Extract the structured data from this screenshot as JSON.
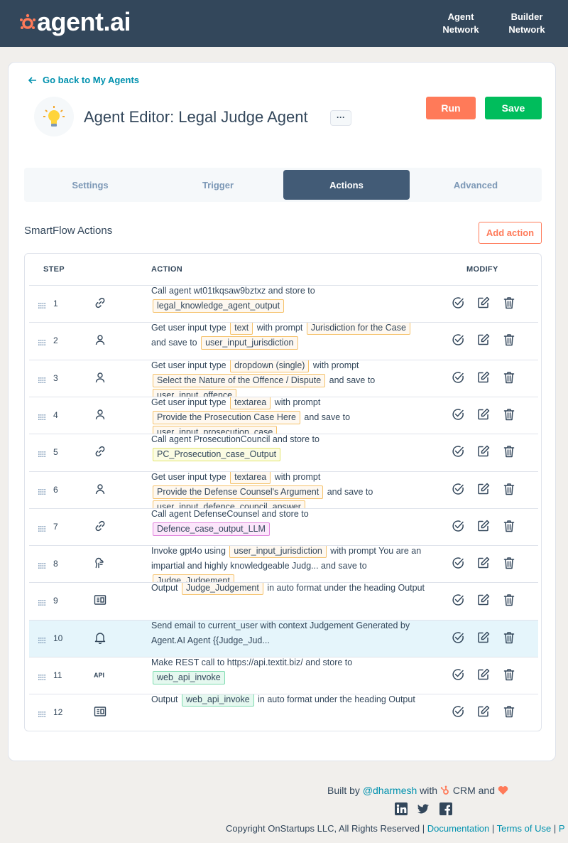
{
  "header": {
    "logo_text": "agent.ai",
    "nav": [
      {
        "line1": "Agent",
        "line2": "Network"
      },
      {
        "line1": "Builder",
        "line2": "Network"
      }
    ]
  },
  "editor": {
    "back_label": "Go back to My Agents",
    "title": "Agent Editor: Legal Judge Agent",
    "more_label": "···",
    "run_label": "Run",
    "save_label": "Save",
    "tabs": [
      "Settings",
      "Trigger",
      "Actions",
      "Advanced"
    ],
    "active_tab": "Actions",
    "section_title": "SmartFlow Actions",
    "add_action_label": "Add action"
  },
  "table": {
    "headers": {
      "step": "STEP",
      "action": "ACTION",
      "modify": "MODIFY"
    },
    "rows": [
      {
        "step": "1",
        "icon": "link-icon",
        "parts": [
          [
            "t",
            "Call agent wt01tkqsaw9bztxz and store to "
          ],
          [
            "tag",
            "legal_knowledge_agent_output"
          ]
        ]
      },
      {
        "step": "2",
        "icon": "user-icon",
        "parts": [
          [
            "t",
            "Get user input type "
          ],
          [
            "tag",
            "text"
          ],
          [
            "t",
            " with prompt "
          ],
          [
            "tag",
            "Jurisdiction for the Case"
          ],
          [
            "t",
            " and save to "
          ],
          [
            "tag",
            "user_input_jurisdiction"
          ]
        ]
      },
      {
        "step": "3",
        "icon": "user-icon",
        "parts": [
          [
            "t",
            "Get user input type "
          ],
          [
            "tag",
            "dropdown (single)"
          ],
          [
            "t",
            " with prompt "
          ],
          [
            "tag",
            "Select the Nature of the Offence / Dispute"
          ],
          [
            "t",
            " and save to "
          ],
          [
            "tag",
            "user_input_offence"
          ]
        ]
      },
      {
        "step": "4",
        "icon": "user-icon",
        "parts": [
          [
            "t",
            "Get user input type "
          ],
          [
            "tag",
            "textarea"
          ],
          [
            "t",
            " with prompt "
          ],
          [
            "tag",
            "Provide the Prosecution Case Here"
          ],
          [
            "t",
            " and save to "
          ],
          [
            "tag",
            "user_input_prosecution_case"
          ]
        ]
      },
      {
        "step": "5",
        "icon": "link-icon",
        "parts": [
          [
            "t",
            "Call agent ProsecutionCouncil and store to "
          ],
          [
            "tag-yellow",
            "PC_Prosecution_case_Output"
          ]
        ]
      },
      {
        "step": "6",
        "icon": "user-icon",
        "parts": [
          [
            "t",
            "Get user input type "
          ],
          [
            "tag",
            "textarea"
          ],
          [
            "t",
            " with prompt "
          ],
          [
            "tag",
            "Provide the Defense Counsel's Argument"
          ],
          [
            "t",
            " and save to "
          ],
          [
            "tag",
            "user_input_defence_council_answer"
          ]
        ]
      },
      {
        "step": "7",
        "icon": "link-icon",
        "parts": [
          [
            "t",
            "Call agent DefenseCounsel and store to "
          ],
          [
            "tag-pink",
            "Defence_case_output_LLM"
          ]
        ]
      },
      {
        "step": "8",
        "icon": "brain-icon",
        "parts": [
          [
            "t",
            "Invoke gpt4o using "
          ],
          [
            "tag",
            "user_input_jurisdiction"
          ],
          [
            "t",
            " with prompt You are an impartial and highly knowledgeable Judg... and save to "
          ],
          [
            "tag",
            "Judge_Judgement"
          ]
        ]
      },
      {
        "step": "9",
        "icon": "output-icon",
        "parts": [
          [
            "t",
            "Output "
          ],
          [
            "tag",
            "Judge_Judgement"
          ],
          [
            "t",
            " in auto format under the heading Output"
          ]
        ]
      },
      {
        "step": "10",
        "icon": "bell-icon",
        "parts": [
          [
            "t",
            "Send email to current_user with context Judgement Generated by Agent.AI Agent {{Judge_Jud..."
          ]
        ]
      },
      {
        "step": "11",
        "icon": "api-icon",
        "parts": [
          [
            "t",
            "Make REST call to https://api.textit.biz/ and store to "
          ],
          [
            "tag-green",
            "web_api_invoke"
          ]
        ]
      },
      {
        "step": "12",
        "icon": "output-icon",
        "parts": [
          [
            "t",
            "Output "
          ],
          [
            "tag-green",
            "web_api_invoke"
          ],
          [
            "t",
            " in auto format under the heading Output"
          ]
        ]
      }
    ]
  },
  "footer": {
    "built_by": "Built by",
    "handle": "@dharmesh",
    "with": "with",
    "crm": "CRM and",
    "copyright": "Copyright OnStartups LLC, All Rights Reserved |",
    "documentation": "Documentation",
    "sep": "|",
    "terms": "Terms of Use",
    "privacy_initial": "P"
  },
  "colors": {
    "header_bg": "#33475b",
    "accent_orange": "#ff7a59",
    "save_green": "#00bd5c",
    "link_teal": "#0091ae",
    "active_tab": "#425b76"
  }
}
